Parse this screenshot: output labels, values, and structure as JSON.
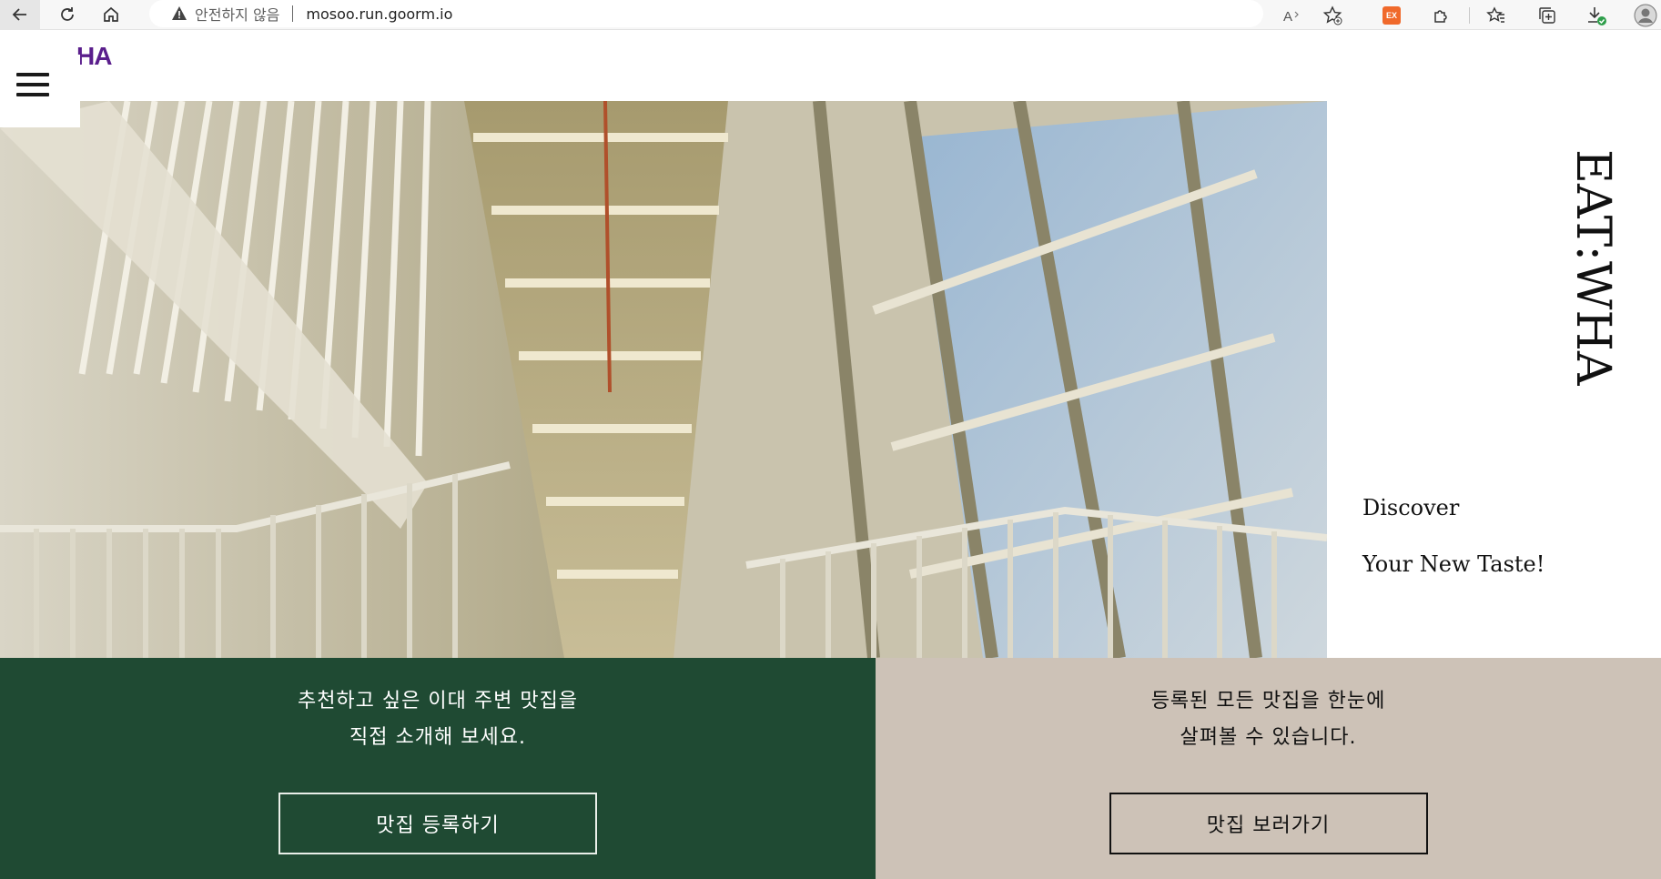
{
  "browser": {
    "security_label": "안전하지 않음",
    "url": "mosoo.run.goorm.io",
    "icons": [
      "back-icon",
      "refresh-icon",
      "home-icon",
      "warning-icon",
      "read-aloud-icon",
      "add-favorite-icon",
      "ex-extension-icon",
      "extensions-icon",
      "favorites-icon",
      "collections-icon",
      "downloads-icon",
      "profile-icon"
    ],
    "extension_badge": "EX"
  },
  "site": {
    "logo_text": "HA",
    "brand_vertical": "EAT:WHA",
    "tagline_line1": "Discover",
    "tagline_line2": "Your New Taste!",
    "accent_color": "#5a1e8c"
  },
  "panels": {
    "left": {
      "line1": "추천하고 싶은 이대 주변 맛집을",
      "line2": "직접 소개해 보세요.",
      "button": "맛집 등록하기",
      "bg": "#1f4a33"
    },
    "right": {
      "line1": "등록된 모든 맛집을 한눈에",
      "line2": "살펴볼 수 있습니다.",
      "button": "맛집 보러가기",
      "bg": "#cdc2b7"
    }
  }
}
